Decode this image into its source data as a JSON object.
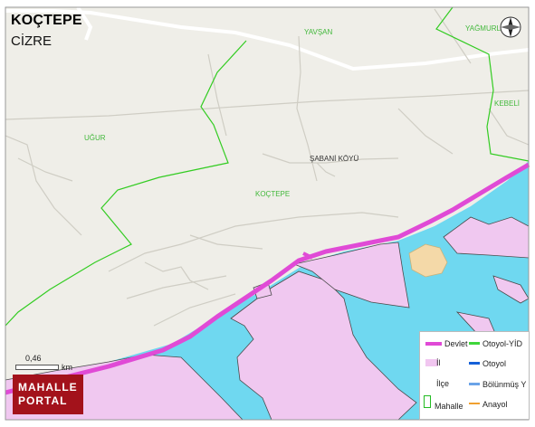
{
  "header": {
    "title": "KOÇTEPE",
    "subtitle": "CİZRE"
  },
  "map_labels": [
    {
      "id": "yavsan",
      "text": "YAVŞAN"
    },
    {
      "id": "yagmurlu",
      "text": "YAĞMURLU"
    },
    {
      "id": "kebeli",
      "text": "KEBELİ"
    },
    {
      "id": "ugur",
      "text": "UĞUR"
    },
    {
      "id": "sabani",
      "text": "ŞABANİ KÖYÜ"
    },
    {
      "id": "koctepe",
      "text": "KOÇTEPE"
    }
  ],
  "scale": {
    "value": "0,46",
    "unit": "km"
  },
  "logo": {
    "line1": "MAHALLE",
    "line2": "PORTAL"
  },
  "legend": {
    "items": [
      {
        "label": "Devlet",
        "color": "#e04ad6",
        "kind": "thick-line"
      },
      {
        "label": "Otoyol-YİD",
        "color": "#3ed63a",
        "kind": "line"
      },
      {
        "label": "İl",
        "color": "#f1c6f0",
        "kind": "fill"
      },
      {
        "label": "Otoyol",
        "color": "#1560d8",
        "kind": "line"
      },
      {
        "label": "İlçe",
        "color": "#ffffff",
        "kind": "none"
      },
      {
        "label": "Bölünmüş Y",
        "color": "#6aa3e8",
        "kind": "line"
      },
      {
        "label": "Mahalle",
        "color": "#22bb22",
        "kind": "outline"
      },
      {
        "label": "Anayol",
        "color": "#f0a030",
        "kind": "line"
      }
    ]
  },
  "colors": {
    "land": "#efeee8",
    "water": "#6fd8f0",
    "district": "#f0c8f0",
    "boundary": "#33cc22",
    "main_road": "#e04ad6",
    "minor_road": "#cfcdc4",
    "settlement": "#f4d9a8"
  }
}
